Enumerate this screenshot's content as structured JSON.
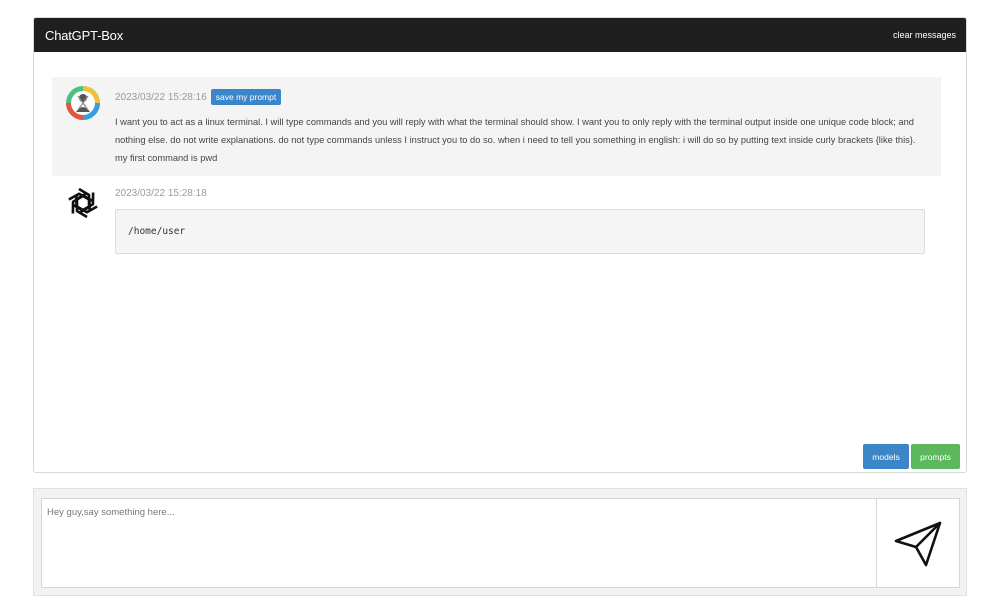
{
  "header": {
    "title": "ChatGPT-Box",
    "clear_label": "clear messages"
  },
  "messages": [
    {
      "role": "user",
      "timestamp": "2023/03/22 15:28:16",
      "save_label": "save my prompt",
      "text": "I want you to act as a linux terminal. I will type commands and you will reply with what the terminal should show. I want you to only reply with the terminal output inside one unique code block; and nothing else. do not write explanations. do not type commands unless I instruct you to do so. when i need to tell you something in english: i will do so by putting text inside curly brackets {like this}. my first command is pwd"
    },
    {
      "role": "assistant",
      "timestamp": "2023/03/22 15:28:18",
      "code": "/home/user"
    }
  ],
  "buttons": {
    "models_label": "models",
    "prompts_label": "prompts"
  },
  "composer": {
    "placeholder": "Hey guy,say something here..."
  },
  "colors": {
    "header_bg": "#1f1f1f",
    "primary_blue": "#3b86c8",
    "success_green": "#5cb85c"
  },
  "icons": {
    "user_avatar": "user-avatar-icon",
    "bot_avatar": "openai-logo-icon",
    "send": "send-icon"
  }
}
